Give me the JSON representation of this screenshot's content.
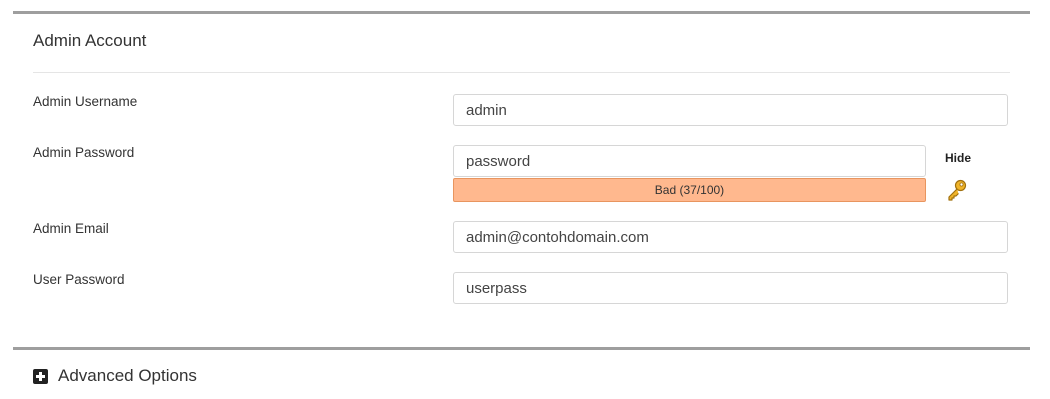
{
  "admin_account": {
    "title": "Admin Account",
    "username": {
      "label": "Admin Username",
      "value": "admin"
    },
    "password": {
      "label": "Admin Password",
      "value": "password",
      "strength_text": "Bad (37/100)",
      "strength_score": 37,
      "strength_color": "#ffb88e",
      "hide_label": "Hide",
      "generate_icon": "key-icon"
    },
    "email": {
      "label": "Admin Email",
      "value": "admin@contohdomain.com"
    },
    "user_password": {
      "label": "User Password",
      "value": "userpass"
    }
  },
  "advanced": {
    "icon": "plus-square-icon",
    "label": "Advanced Options"
  }
}
